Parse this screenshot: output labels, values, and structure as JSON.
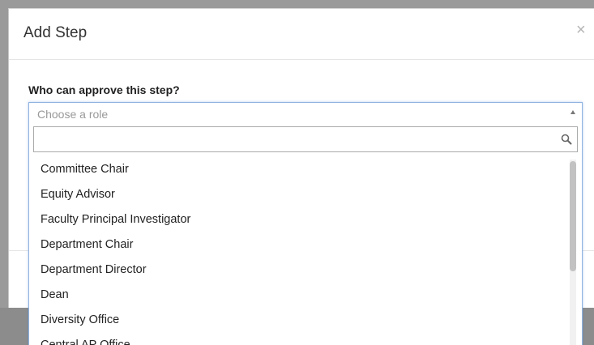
{
  "modal": {
    "title": "Add Step",
    "close_symbol": "×",
    "question": "Who can approve this step?"
  },
  "role_select": {
    "selected_text": "Choose a role",
    "arrow_icon": "caret-up-icon",
    "search": {
      "value": "",
      "placeholder": "",
      "icon": "search-icon"
    },
    "options": [
      "Committee Chair",
      "Equity Advisor",
      "Faculty Principal Investigator",
      "Department Chair",
      "Department Director",
      "Dean",
      "Diversity Office",
      "Central AP Office"
    ]
  },
  "colors": {
    "focus_border": "#8fb3e0",
    "backdrop": "#9a9a9a",
    "text": "#222222",
    "placeholder_text": "#999999"
  }
}
